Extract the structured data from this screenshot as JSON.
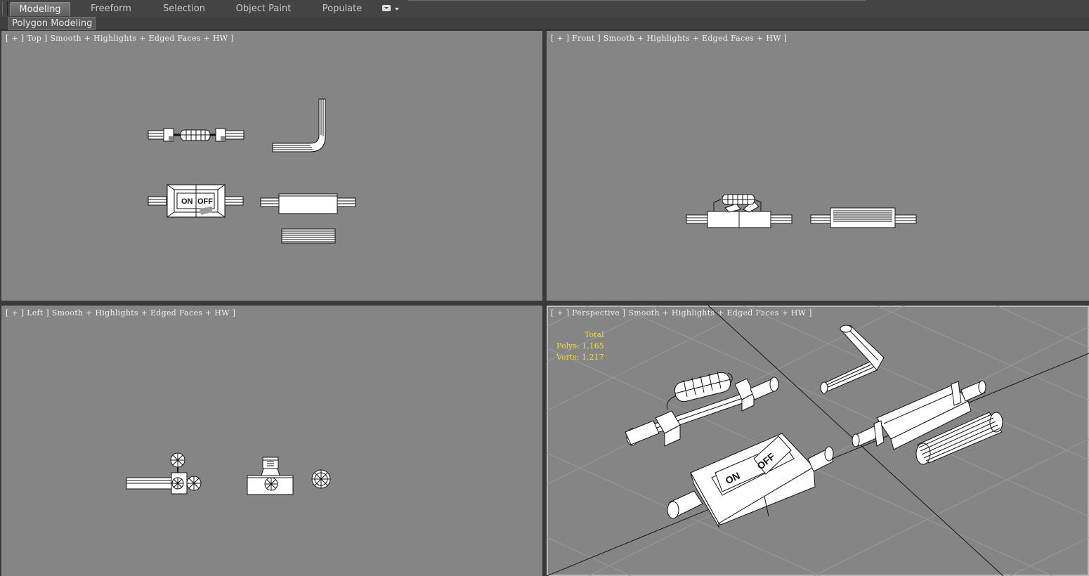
{
  "ribbon": {
    "tabs": [
      {
        "label": "Modeling",
        "active": true
      },
      {
        "label": "Freeform",
        "active": false
      },
      {
        "label": "Selection",
        "active": false
      },
      {
        "label": "Object Paint",
        "active": false
      },
      {
        "label": "Populate",
        "active": false
      }
    ],
    "options_icon": "dropdown-icon"
  },
  "subbar": {
    "label": "Polygon Modeling"
  },
  "viewports": [
    {
      "caption": "[ + ] Top ] Smooth + Highlights + Edged Faces + HW ]"
    },
    {
      "caption": "[ + ] Front ] Smooth + Highlights + Edged Faces + HW ]"
    },
    {
      "caption": "[ + ] Left ] Smooth + Highlights + Edged Faces + HW ]"
    },
    {
      "caption": "[ + ] Perspective ] Smooth + Highlights + Edged Faces + HW ]"
    }
  ],
  "stats": {
    "title": "Total",
    "polys": "Polys: 1,165",
    "verts": "Verts: 1,217"
  },
  "labels": {
    "on": "ON",
    "off": "OFF"
  },
  "colors": {
    "viewport_bg": "#858585",
    "stats_text": "#f0e42a",
    "ui_bg": "#3a3a3a"
  }
}
